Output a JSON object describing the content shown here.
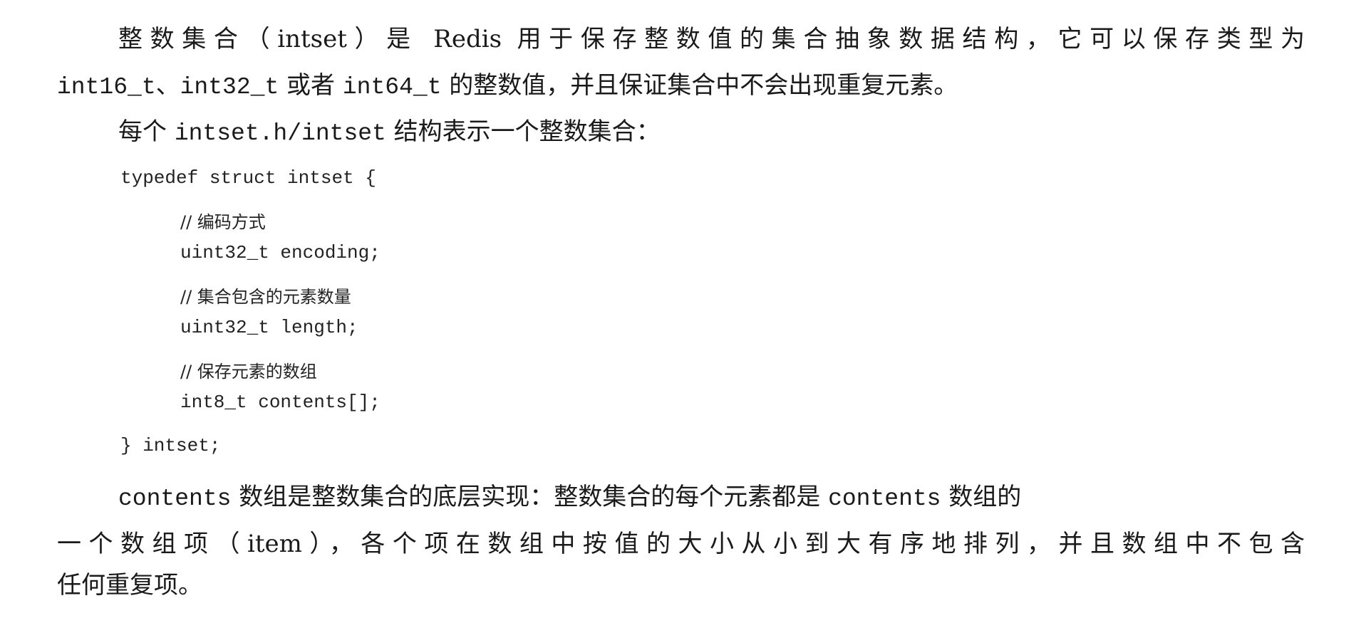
{
  "paragraphs": {
    "p1": {
      "l1_a": "整数集合（intset）是 Redis 用于保存整数值的集合抽象数据结构，它可以保存类型为",
      "l2_c1": "int16_t",
      "l2_t1": "、",
      "l2_c2": "int32_t",
      "l2_t2": " 或者 ",
      "l2_c3": "int64_t",
      "l2_t3": " 的整数值，并且保证集合中不会出现重复元素。"
    },
    "p2": {
      "t1": "每个 ",
      "c1": "intset.h/intset",
      "t2": " 结构表示一个整数集合："
    },
    "code": {
      "open": "typedef struct intset {",
      "comment1": "// 编码方式",
      "field1": "uint32_t encoding;",
      "comment2": "// 集合包含的元素数量",
      "field2": "uint32_t length;",
      "comment3": "// 保存元素的数组",
      "field3": "int8_t contents[];",
      "close": "} intset;"
    },
    "p3": {
      "l1_c1": "contents",
      "l1_t1": " 数组是整数集合的底层实现：整数集合的每个元素都是 ",
      "l1_c2": "contents",
      "l1_t2": " 数组的",
      "l2": "一个数组项（item），各个项在数组中按值的大小从小到大有序地排列，并且数组中不包含",
      "l3": "任何重复项。"
    }
  }
}
